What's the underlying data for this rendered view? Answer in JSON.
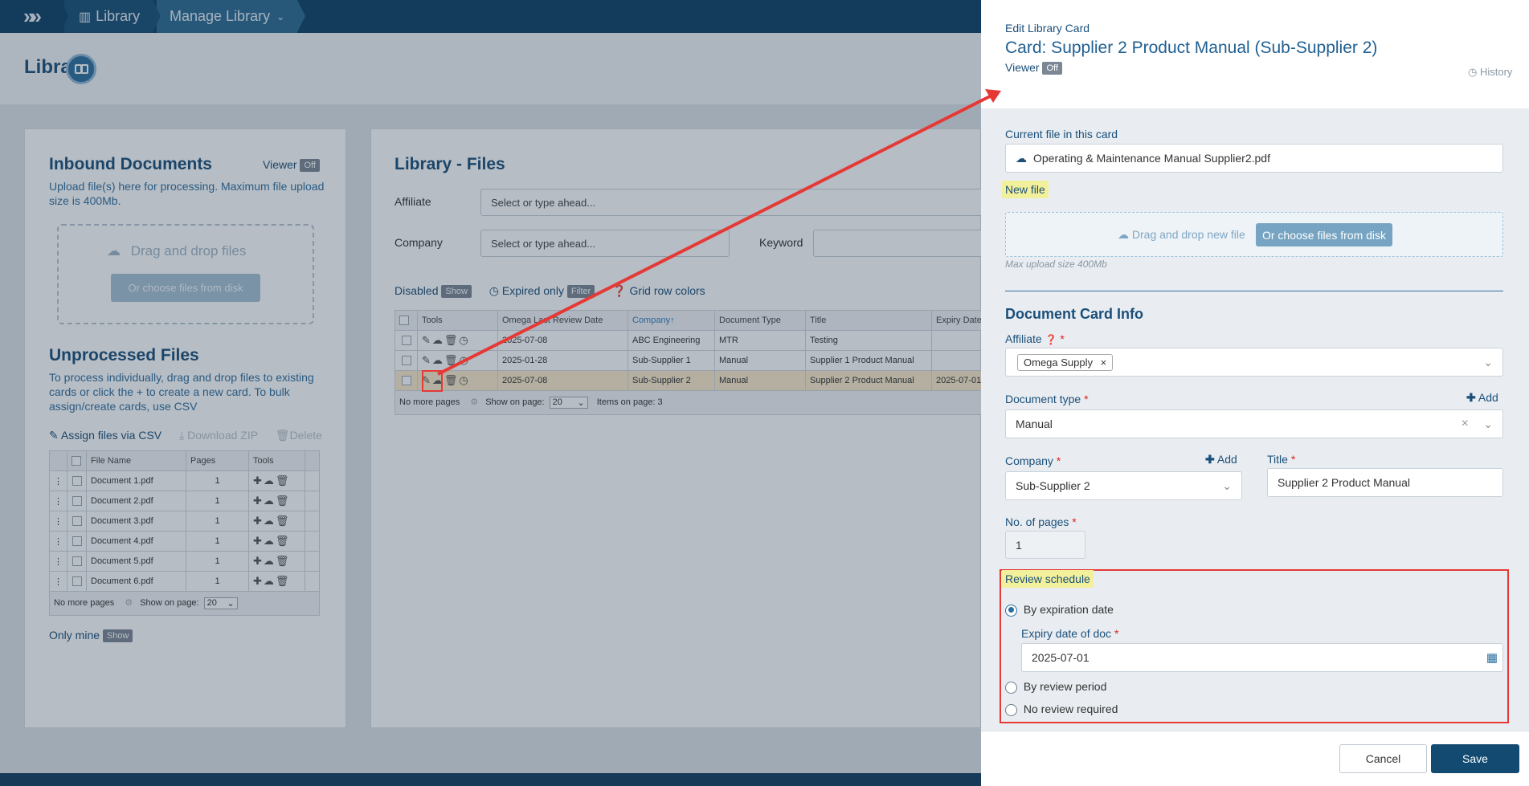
{
  "nav": {
    "library": "Library",
    "manage": "Manage Library"
  },
  "page": {
    "title": "Library"
  },
  "inbound": {
    "title": "Inbound Documents",
    "viewer_label": "Viewer",
    "viewer_state": "Off",
    "desc": "Upload file(s) here for processing. Maximum file upload size is 400Mb.",
    "drag_text": "Drag and drop files",
    "choose_btn": "Or choose files from disk"
  },
  "unprocessed": {
    "title": "Unprocessed Files",
    "desc": "To process individually, drag and drop files to existing cards or click the + to create a new card. To bulk assign/create cards, use CSV",
    "assign_csv": "Assign files via CSV",
    "download_zip": "Download ZIP",
    "delete": "Delete",
    "columns": [
      "File Name",
      "Pages",
      "Tools"
    ],
    "rows": [
      {
        "name": "Document 1.pdf",
        "pages": "1"
      },
      {
        "name": "Document 2.pdf",
        "pages": "1"
      },
      {
        "name": "Document 3.pdf",
        "pages": "1"
      },
      {
        "name": "Document 4.pdf",
        "pages": "1"
      },
      {
        "name": "Document 5.pdf",
        "pages": "1"
      },
      {
        "name": "Document 6.pdf",
        "pages": "1"
      }
    ],
    "no_more_pages": "No more pages",
    "show_on_page": "Show on page:",
    "page_size": "20",
    "only_mine": "Only mine",
    "only_mine_pill": "Show"
  },
  "libfiles": {
    "title": "Library - Files",
    "affiliate_label": "Affiliate",
    "company_label": "Company",
    "keyword_label": "Keyword",
    "placeholder": "Select or type ahead...",
    "disabled": "Disabled",
    "disabled_pill": "Show",
    "expired_only": "Expired only",
    "expired_pill": "Filter",
    "grid_colors": "Grid row colors",
    "columns": [
      "Tools",
      "Omega Last Review Date",
      "Company",
      "Document Type",
      "Title",
      "Expiry Date"
    ],
    "rows": [
      {
        "date": "2025-07-08",
        "company": "ABC Engineering",
        "type": "MTR",
        "title": "Testing",
        "expiry": ""
      },
      {
        "date": "2025-01-28",
        "company": "Sub-Supplier 1",
        "type": "Manual",
        "title": "Supplier 1 Product Manual",
        "expiry": ""
      },
      {
        "date": "2025-07-08",
        "company": "Sub-Supplier 2",
        "type": "Manual",
        "title": "Supplier 2 Product Manual",
        "expiry": "2025-07-01"
      }
    ],
    "no_more_pages": "No more pages",
    "show_on_page": "Show on page:",
    "page_size": "20",
    "items_on_page": "Items on page: 3"
  },
  "panel": {
    "subtitle": "Edit Library Card",
    "title": "Card: Supplier 2 Product Manual (Sub-Supplier 2)",
    "viewer_label": "Viewer",
    "viewer_state": "Off",
    "history": "History",
    "current_file_label": "Current file in this card",
    "current_file": "Operating & Maintenance Manual Supplier2.pdf",
    "new_file_label": "New file",
    "drag_new": "Drag and drop new file",
    "choose_btn": "Or choose files from disk",
    "max_upload": "Max upload size 400Mb",
    "section_title": "Document Card Info",
    "affiliate_label": "Affiliate",
    "affiliate_value": "Omega Supply",
    "doctype_label": "Document type",
    "doctype_value": "Manual",
    "add": "Add",
    "company_label": "Company",
    "company_value": "Sub-Supplier 2",
    "title_label": "Title",
    "title_value": "Supplier 2 Product Manual",
    "pages_label": "No. of pages",
    "pages_value": "1",
    "review_label": "Review schedule",
    "by_expiration": "By expiration date",
    "expiry_label": "Expiry date of doc",
    "expiry_value": "2025-07-01",
    "by_review": "By review period",
    "no_review": "No review required",
    "cancel": "Cancel",
    "save": "Save"
  },
  "colors": {
    "accent": "#0e4266",
    "highlight": "#f3f09b",
    "annotation": "#e53935"
  }
}
